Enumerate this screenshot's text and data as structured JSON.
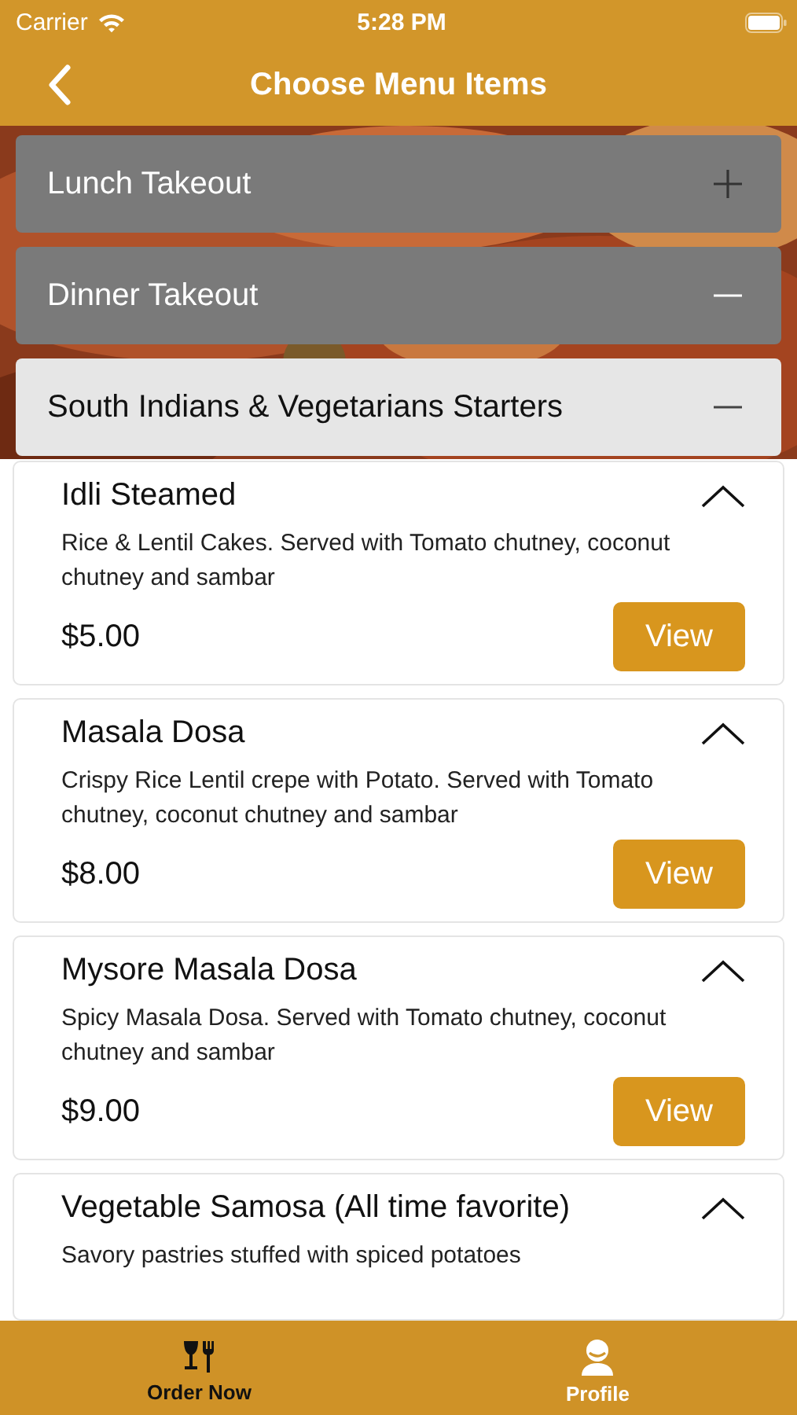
{
  "status_bar": {
    "carrier": "Carrier",
    "time": "5:28 PM"
  },
  "nav_bar": {
    "title": "Choose Menu Items"
  },
  "sections": [
    {
      "title": "Lunch Takeout",
      "expanded": false,
      "selected": false
    },
    {
      "title": "Dinner Takeout",
      "expanded": true,
      "selected": false
    },
    {
      "title": "South Indians & Vegetarians Starters",
      "expanded": true,
      "selected": true
    }
  ],
  "items": [
    {
      "name": "Idli Steamed",
      "description": "Rice & Lentil Cakes. Served with Tomato chutney, coconut chutney and sambar",
      "price": "$5.00",
      "button": "View"
    },
    {
      "name": "Masala Dosa",
      "description": "Crispy Rice Lentil crepe with Potato. Served with Tomato chutney, coconut chutney and sambar",
      "price": "$8.00",
      "button": "View"
    },
    {
      "name": "Mysore Masala Dosa",
      "description": "Spicy Masala Dosa. Served with Tomato chutney, coconut chutney and sambar",
      "price": "$9.00",
      "button": "View"
    },
    {
      "name": "Vegetable Samosa (All time favorite)",
      "description": "Savory pastries stuffed with spiced potatoes"
    }
  ],
  "tab_bar": [
    {
      "label": "Order Now",
      "kind": "order",
      "selected": true
    },
    {
      "label": "Profile",
      "kind": "profile",
      "selected": false
    }
  ]
}
